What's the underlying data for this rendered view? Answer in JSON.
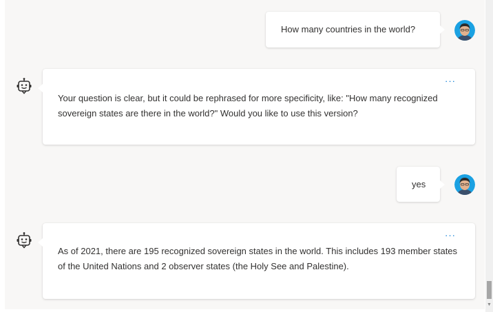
{
  "conversation": {
    "messages": [
      {
        "role": "user",
        "text": "How many countries in the world?"
      },
      {
        "role": "bot",
        "text": "Your question is clear, but it could be rephrased for more specificity, like: \"How many recognized sovereign states are there in the world?\" Would you like to use this version?",
        "more_label": "···"
      },
      {
        "role": "user",
        "text": "yes"
      },
      {
        "role": "bot",
        "text": "As of 2021, there are 195 recognized sovereign states in the world. This includes 193 member states of the United Nations and 2 observer states (the Holy See and Palestine).",
        "more_label": "···"
      }
    ]
  },
  "icons": {
    "user_avatar": "user-avatar",
    "bot_avatar": "robot-icon",
    "more": "more-options-icon"
  },
  "colors": {
    "pane_background": "#f8f7f6",
    "bubble_background": "#ffffff",
    "text": "#323130",
    "accent": "#0078d4",
    "avatar_ring": "#1ba1e2"
  }
}
